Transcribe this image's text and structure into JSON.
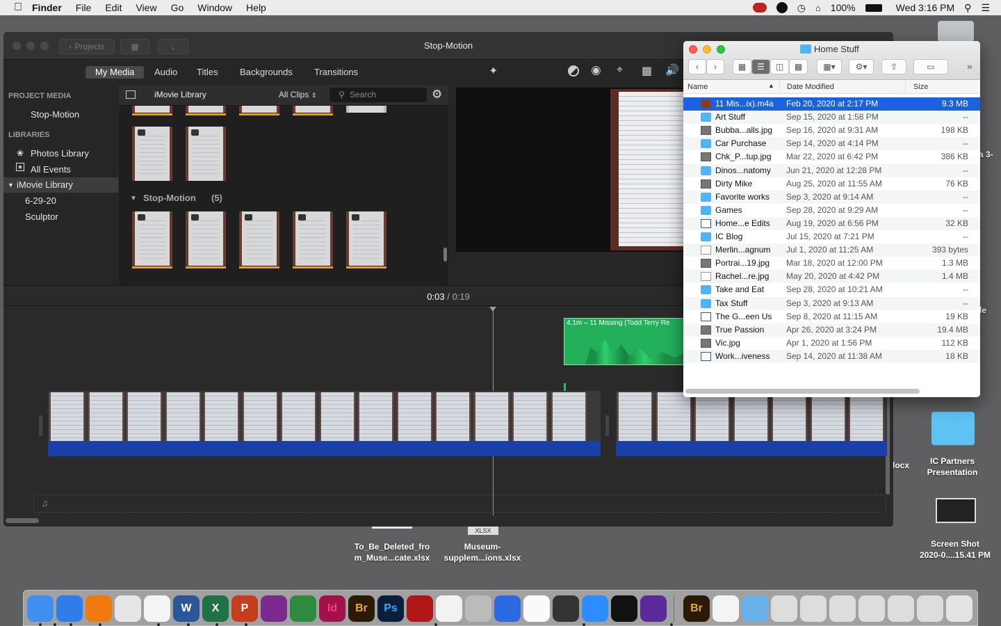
{
  "menubar": {
    "app": "Finder",
    "items": [
      "File",
      "Edit",
      "View",
      "Go",
      "Window",
      "Help"
    ],
    "battery": "100%",
    "clock": "Wed 3:16 PM"
  },
  "imovie": {
    "title": "Stop-Motion",
    "projects_label": "Projects",
    "tabs": [
      "My Media",
      "Audio",
      "Titles",
      "Backgrounds",
      "Transitions"
    ],
    "sidebar": {
      "project_media_header": "PROJECT MEDIA",
      "project": "Stop-Motion",
      "libraries_header": "LIBRARIES",
      "photos_library": "Photos Library",
      "all_events": "All Events",
      "library": "iMovie Library",
      "events": [
        "6-29-20",
        "Sculptor"
      ]
    },
    "browser": {
      "library_name": "iMovie Library",
      "filter": "All Clips",
      "search_placeholder": "Search",
      "group_title": "Stop-Motion",
      "group_count": "(5)"
    },
    "timecode": {
      "current": "0:03",
      "separator": "/",
      "total": "0:19"
    },
    "audio_clip_label": "4.1m – 11 Missing (Todd Terry Re"
  },
  "finder": {
    "title": "Home Stuff",
    "columns": {
      "name": "Name",
      "date": "Date Modified",
      "size": "Size"
    },
    "rows": [
      {
        "name": "11 Mis...ix).m4a",
        "date": "Feb 20, 2020 at 2:17 PM",
        "size": "9.3 MB",
        "icon": "audio",
        "selected": true
      },
      {
        "name": "Art Stuff",
        "date": "Sep 15, 2020 at 1:58 PM",
        "size": "--",
        "icon": "folder"
      },
      {
        "name": "Bubba...alls.jpg",
        "date": "Sep 16, 2020 at 9:31 AM",
        "size": "198 KB",
        "icon": "image"
      },
      {
        "name": "Car Purchase",
        "date": "Sep 14, 2020 at 4:14 PM",
        "size": "--",
        "icon": "folder"
      },
      {
        "name": "Chk_P...tup.jpg",
        "date": "Mar 22, 2020 at 6:42 PM",
        "size": "386 KB",
        "icon": "image"
      },
      {
        "name": "Dinos...natomy",
        "date": "Jun 21, 2020 at 12:28 PM",
        "size": "--",
        "icon": "folder"
      },
      {
        "name": "Dirty Mike",
        "date": "Aug 25, 2020 at 11:55 AM",
        "size": "76 KB",
        "icon": "image"
      },
      {
        "name": "Favorite works",
        "date": "Sep 3, 2020 at 9:14 AM",
        "size": "--",
        "icon": "folder"
      },
      {
        "name": "Games",
        "date": "Sep 28, 2020 at 9:29 AM",
        "size": "--",
        "icon": "folder"
      },
      {
        "name": "Home...e Edits",
        "date": "Aug 19, 2020 at 6:56 PM",
        "size": "32 KB",
        "icon": "word"
      },
      {
        "name": "IC Blog",
        "date": "Jul 15, 2020 at 7:21 PM",
        "size": "--",
        "icon": "folder"
      },
      {
        "name": "Merlin...agnum",
        "date": "Jul 1, 2020 at 11:25 AM",
        "size": "393 bytes",
        "icon": "doc"
      },
      {
        "name": "Portrai...19.jpg",
        "date": "Mar 18, 2020 at 12:00 PM",
        "size": "1.3 MB",
        "icon": "image"
      },
      {
        "name": "Rachel...re.jpg",
        "date": "May 20, 2020 at 4:42 PM",
        "size": "1.4 MB",
        "icon": "doc"
      },
      {
        "name": "Take and Eat",
        "date": "Sep 28, 2020 at 10:21 AM",
        "size": "--",
        "icon": "folder"
      },
      {
        "name": "Tax Stuff",
        "date": "Sep 3, 2020 at 9:13 AM",
        "size": "--",
        "icon": "folder"
      },
      {
        "name": "The G...een Us",
        "date": "Sep 8, 2020 at 11:15 AM",
        "size": "19 KB",
        "icon": "word"
      },
      {
        "name": "True Passion",
        "date": "Apr 26, 2020 at 3:24 PM",
        "size": "19.4 MB",
        "icon": "image"
      },
      {
        "name": "Vic.jpg",
        "date": "Apr 1, 2020 at 1:56 PM",
        "size": "112 KB",
        "icon": "image"
      },
      {
        "name": "Work...iveness",
        "date": "Sep 14, 2020 at 11:38 AM",
        "size": "18 KB",
        "icon": "word"
      }
    ]
  },
  "desktop": {
    "ic_partners": "IC Partners\nPresentation",
    "screenshot": "Screen Shot\n2020-0....15.41 PM",
    "file1": "To_Be_Deleted_fro\nm_Muse...cate.xlsx",
    "file2": "Museum-\nsupplem...ions.xlsx",
    "xlsx_badge": "XLSX",
    "partial_docx": "locx",
    "partial_a3": "a 3-",
    "partial_le": "le"
  },
  "dock": {
    "apps": [
      "Finder",
      "Safari",
      "Firefox",
      "Chrome",
      "Photos",
      "Word",
      "Excel",
      "PowerPoint",
      "Business",
      "Sage",
      "InDesign",
      "Bridge",
      "Photoshop",
      "Acrobat",
      "TextEdit",
      "Calculator",
      "Xcode",
      "Slack",
      "Money",
      "Zoom",
      "Terminal",
      "iMovie",
      "Bridge",
      "Document",
      "Applications",
      "Screenshot1",
      "Screenshot2",
      "Screenshot3",
      "Screenshot4",
      "Screenshot5",
      "Screenshot6",
      "Trash"
    ],
    "labels": {
      "word": "W",
      "excel": "X",
      "ppt": "P",
      "indesign": "Id",
      "bridge": "Br",
      "photoshop": "Ps"
    }
  }
}
